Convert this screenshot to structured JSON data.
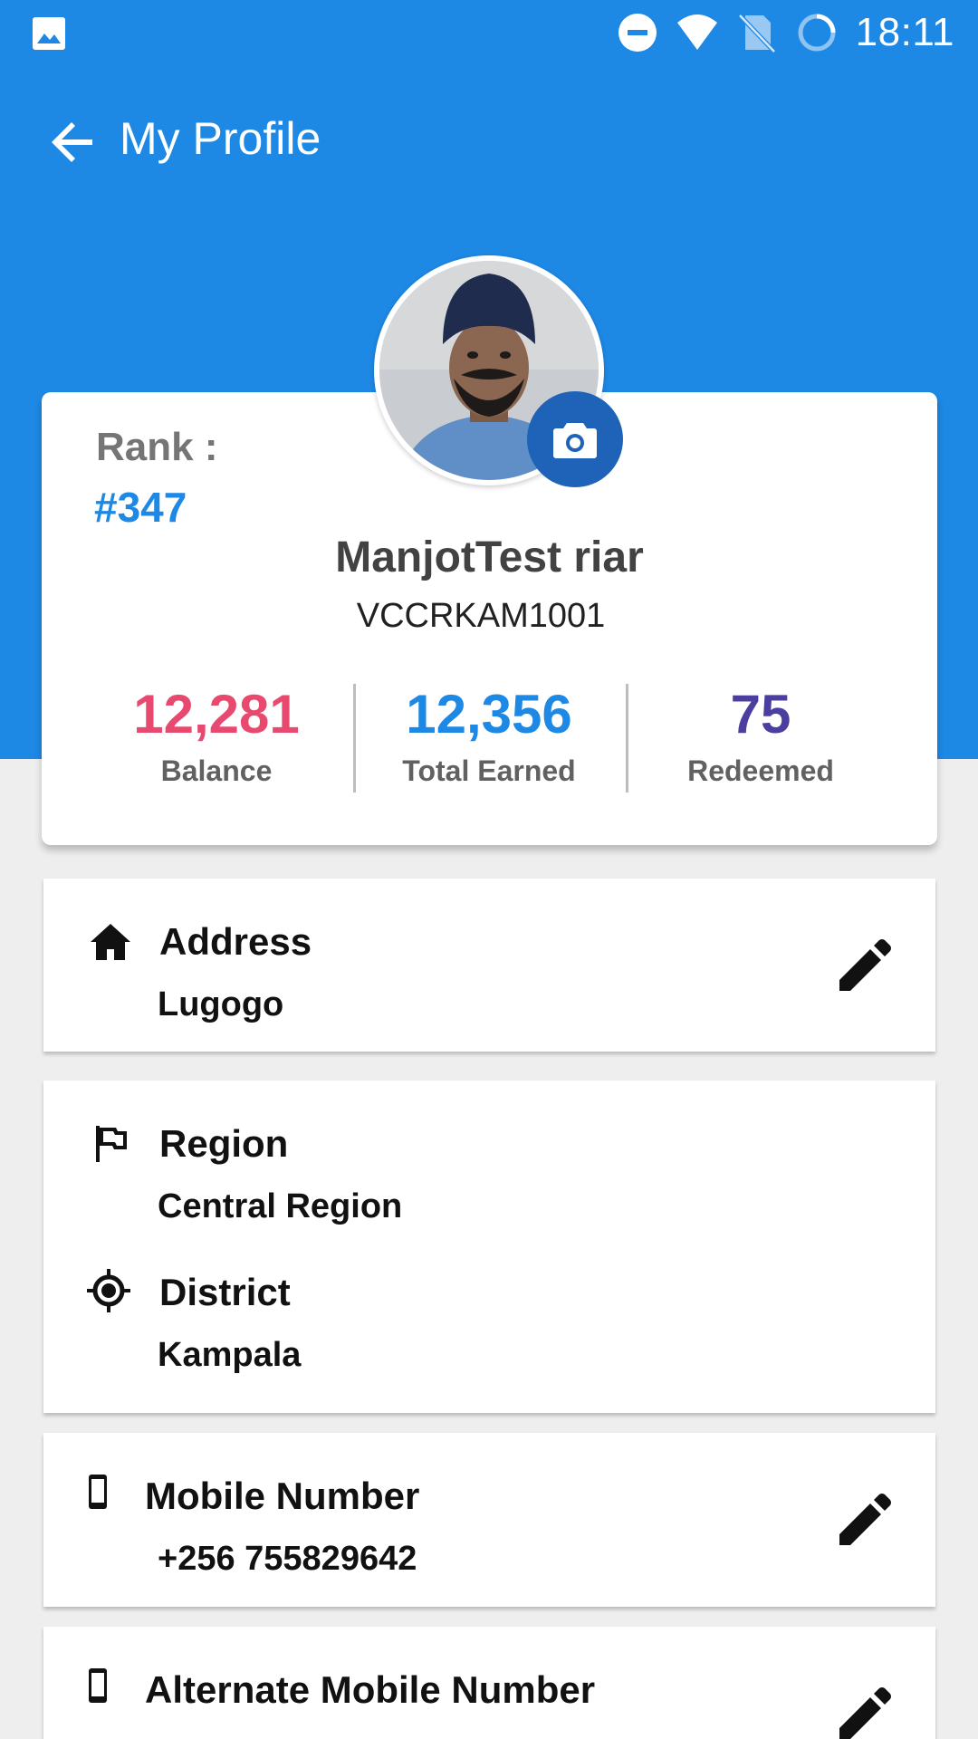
{
  "status_bar": {
    "time": "18:11",
    "icons": [
      "image-icon",
      "do-not-disturb-icon",
      "wifi-icon",
      "no-sim-icon",
      "sync-icon"
    ]
  },
  "toolbar": {
    "title": "My Profile",
    "back_icon": "arrow-back-icon"
  },
  "profile": {
    "rank_label": "Rank :",
    "rank_value": "#347",
    "name": "ManjotTest riar",
    "user_id": "VCCRKAM1001",
    "stats": [
      {
        "value": "12,281",
        "label": "Balance",
        "color": "#e84a6f"
      },
      {
        "value": "12,356",
        "label": "Total Earned",
        "color": "#1e88e5"
      },
      {
        "value": "75",
        "label": "Redeemed",
        "color": "#4a3f9f"
      }
    ]
  },
  "address": {
    "title": "Address",
    "value": "Lugogo",
    "icon": "home-icon"
  },
  "region": {
    "title": "Region",
    "value": "Central Region",
    "icon": "flag-icon"
  },
  "district": {
    "title": "District",
    "value": "Kampala",
    "icon": "gps-target-icon"
  },
  "mobile": {
    "title": "Mobile Number",
    "value": "+256 755829642",
    "icon": "phone-icon"
  },
  "alt_mobile": {
    "title": "Alternate Mobile Number",
    "icon": "phone-icon"
  },
  "colors": {
    "primary": "#1e88e5",
    "camera_button": "#1f63b8",
    "background": "#eeeeee"
  }
}
